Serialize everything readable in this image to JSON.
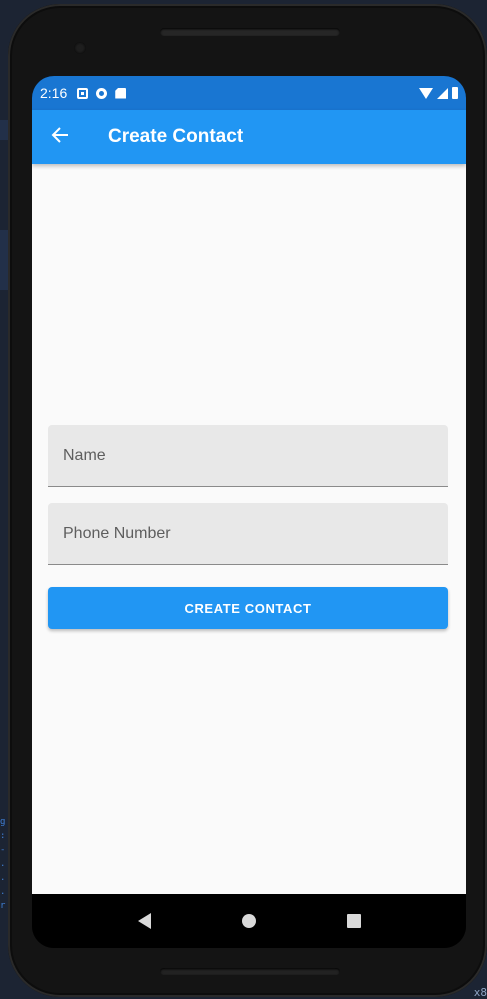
{
  "status_bar": {
    "time": "2:16"
  },
  "app_bar": {
    "title": "Create Contact",
    "back_icon": "arrow-left-icon"
  },
  "form": {
    "name_placeholder": "Name",
    "name_value": "",
    "phone_placeholder": "Phone Number",
    "phone_value": "",
    "submit_label": "CREATE CONTACT"
  },
  "nav_bar": {
    "back_icon": "triangle-back-icon",
    "home_icon": "circle-home-icon",
    "recents_icon": "square-recents-icon"
  },
  "colors": {
    "primary": "#2196f3",
    "status_bar": "#1976d2",
    "background": "#fafafa",
    "field_fill": "#e8e8e8"
  }
}
